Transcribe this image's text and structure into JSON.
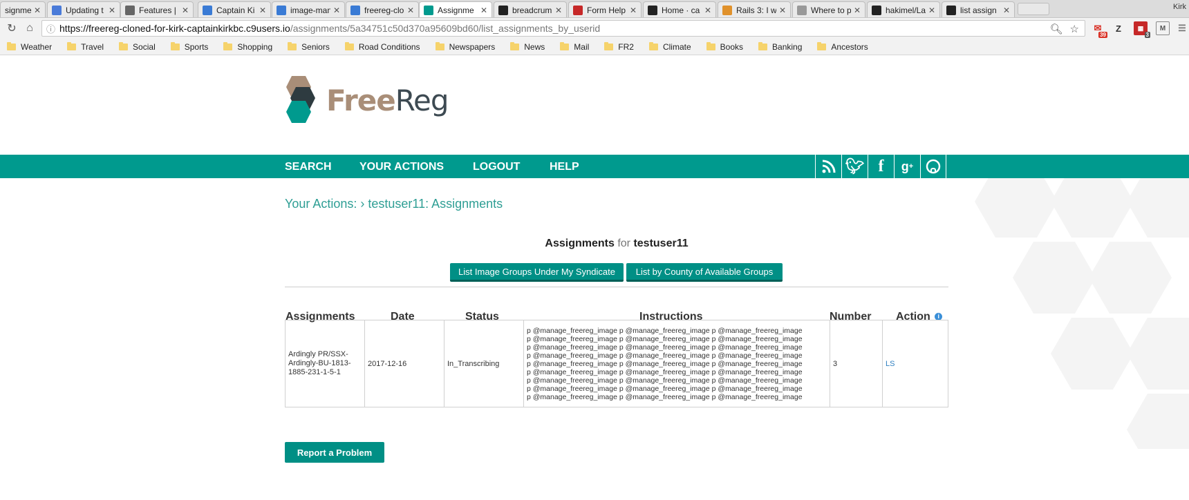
{
  "browser": {
    "tabs": [
      {
        "label": "signme"
      },
      {
        "label": "Updating t"
      },
      {
        "label": "Features | "
      },
      {
        "label": "Captain Ki"
      },
      {
        "label": "image-man"
      },
      {
        "label": "freereg-clo"
      },
      {
        "label": "Assignme"
      },
      {
        "label": "breadcrum"
      },
      {
        "label": "Form Help"
      },
      {
        "label": "Home · ca"
      },
      {
        "label": "Rails 3: I w"
      },
      {
        "label": "Where to p"
      },
      {
        "label": "hakimel/La"
      },
      {
        "label": "list assign"
      }
    ],
    "profile_name": "Kirk",
    "url_host": "https://freereg-cloned-for-kirk-captainkirkbc.c9users.io",
    "url_path": "/assignments/5a34751c50d370a95609bd60/list_assignments_by_userid",
    "extension_badges": {
      "mail": "39",
      "calendar": "3"
    },
    "extension_letters": {
      "z": "Z",
      "m": "M"
    },
    "bookmarks": [
      "Weather",
      "Travel",
      "Social",
      "Sports",
      "Shopping",
      "Seniors",
      "Road Conditions",
      "Newspapers",
      "News",
      "Mail",
      "FR2",
      "Climate",
      "Books",
      "Banking",
      "Ancestors"
    ]
  },
  "site": {
    "logo_free": "Free",
    "logo_reg": "Reg",
    "nav": [
      "SEARCH",
      "YOUR ACTIONS",
      "LOGOUT",
      "HELP"
    ],
    "social": [
      "rss-icon",
      "twitter-icon",
      "facebook-icon",
      "google-plus-icon",
      "github-icon"
    ],
    "brand_color": "#009a8e"
  },
  "main": {
    "breadcrumb": "Your Actions: › testuser11: Assignments",
    "heading_main": "Assignments",
    "heading_for": "for",
    "heading_user": "testuser11",
    "buttons": {
      "list_image_groups": "List Image Groups Under My Syndicate",
      "list_by_county": "List by County of Available Groups"
    },
    "table": {
      "headers": [
        "Assignments",
        "Date",
        "Status",
        "Instructions",
        "Number",
        "Action"
      ],
      "row": {
        "assignment_lines": [
          "Ardingly PR/SSX-",
          "Ardingly-BU-1813-",
          "1885-231-1-5-1"
        ],
        "date": "2017-12-16",
        "status": "In_Transcribing",
        "instruction_line": "p @manage_freereg_image p @manage_freereg_image p @manage_freereg_image",
        "instruction_line_count": 9,
        "number": "3",
        "action": "LS"
      }
    },
    "report_button": "Report a Problem"
  }
}
